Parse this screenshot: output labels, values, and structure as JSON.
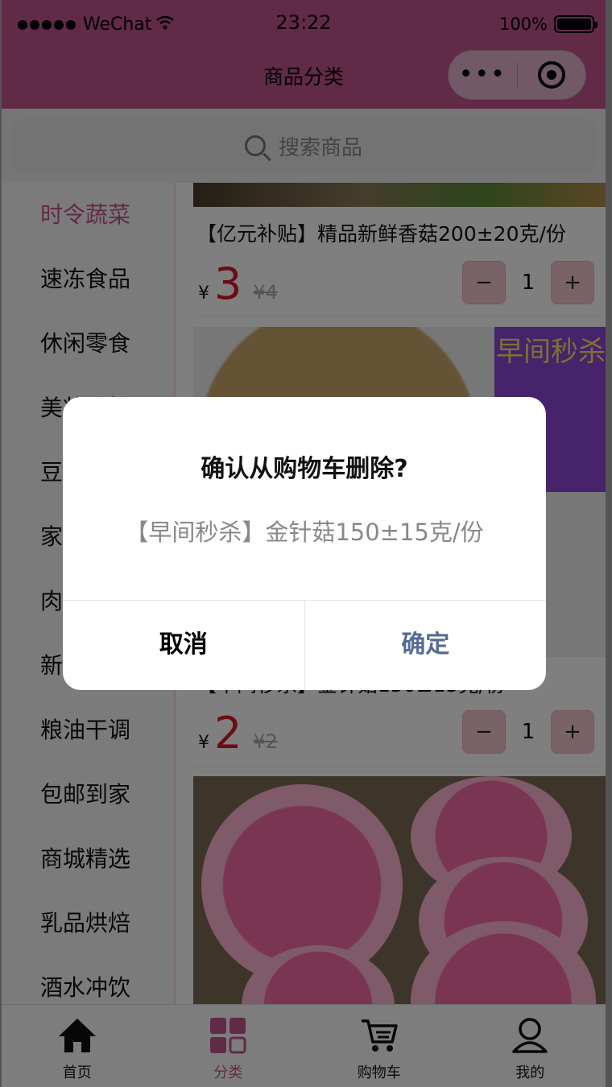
{
  "status_bar": {
    "carrier": "WeChat",
    "time": "23:22",
    "battery": "100%"
  },
  "nav": {
    "title": "商品分类",
    "more_icon": "more-dots-icon",
    "close_icon": "target-icon"
  },
  "search": {
    "placeholder": "搜索商品"
  },
  "categories": [
    "时令蔬菜",
    "速冻食品",
    "休闲零食",
    "美妆个护",
    "豆制品",
    "家居用品",
    "肉禽蛋品",
    "新鲜水果",
    "粮油干调",
    "包邮到家",
    "商城精选",
    "乳品烘焙",
    "酒水冲饮"
  ],
  "active_category_index": 0,
  "products": [
    {
      "name": "【亿元补贴】精品新鲜香菇200±20克/份",
      "currency": "¥",
      "price": "3",
      "old_price": "¥4",
      "qty": "1"
    },
    {
      "name": "【早间秒杀】金针菇150±15克/份",
      "currency": "¥",
      "price": "2",
      "old_price": "¥2",
      "qty": "1",
      "promo_title": "早间秒杀"
    }
  ],
  "stepper": {
    "minus": "−",
    "plus": "+"
  },
  "tabs": [
    {
      "label": "首页",
      "icon": "home-icon"
    },
    {
      "label": "分类",
      "icon": "category-icon"
    },
    {
      "label": "购物车",
      "icon": "cart-icon"
    },
    {
      "label": "我的",
      "icon": "user-icon"
    }
  ],
  "active_tab_index": 1,
  "dialog": {
    "title": "确认从购物车删除?",
    "content": "【早间秒杀】金针菇150±15克/份",
    "cancel": "取消",
    "confirm": "确定"
  },
  "colors": {
    "brand": "#c2558e",
    "price": "#d9182c",
    "confirm": "#576b95"
  }
}
